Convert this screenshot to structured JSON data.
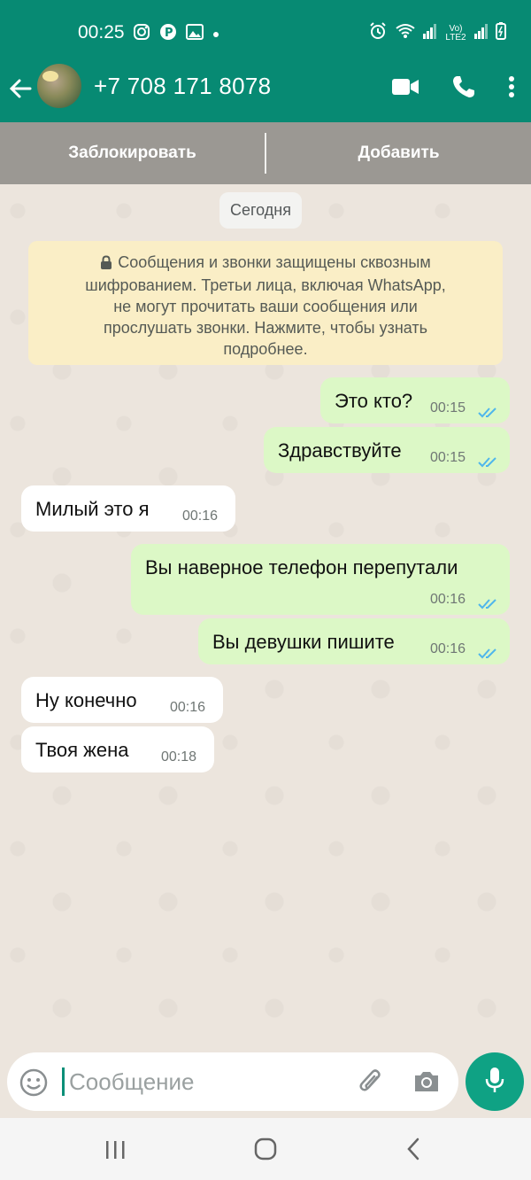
{
  "status_bar": {
    "time": "00:25",
    "network_text": "Vo) LTE2"
  },
  "header": {
    "contact": "+7 708 171 8078",
    "icons": [
      "back-arrow-icon",
      "avatar",
      "video-call-icon",
      "phone-call-icon",
      "more-vert-icon"
    ]
  },
  "action_bar": {
    "block_label": "Заблокировать",
    "add_label": "Добавить"
  },
  "chat": {
    "date_label": "Сегодня",
    "encryption_lines": [
      "Сообщения и звонки защищены сквозным",
      "шифрованием. Третьи лица, включая WhatsApp,",
      "не могут прочитать ваши сообщения или",
      "прослушать звонки. Нажмите, чтобы узнать",
      "подробнее."
    ],
    "messages": [
      {
        "dir": "out",
        "text": "Это кто?",
        "time": "00:15",
        "status": "read"
      },
      {
        "dir": "out",
        "text": "Здравствуйте",
        "time": "00:15",
        "status": "read"
      },
      {
        "dir": "in",
        "text": "Милый это я",
        "time": "00:16"
      },
      {
        "dir": "out",
        "text": "Вы наверное телефон перепутали",
        "time": "00:16",
        "status": "read"
      },
      {
        "dir": "out",
        "text": "Вы девушки пишите",
        "time": "00:16",
        "status": "read"
      },
      {
        "dir": "in",
        "text": "Ну конечно",
        "time": "00:16"
      },
      {
        "dir": "in",
        "text": "Твоя жена",
        "time": "00:18"
      }
    ]
  },
  "composer": {
    "placeholder": "Сообщение"
  },
  "colors": {
    "header": "#078A73",
    "outgoing_bubble": "#DCF8C6",
    "incoming_bubble": "#FFFFFF",
    "encryption_box": "#FAEEC6",
    "read_ticks": "#4FB6EC",
    "mic_button": "#0FA284"
  }
}
